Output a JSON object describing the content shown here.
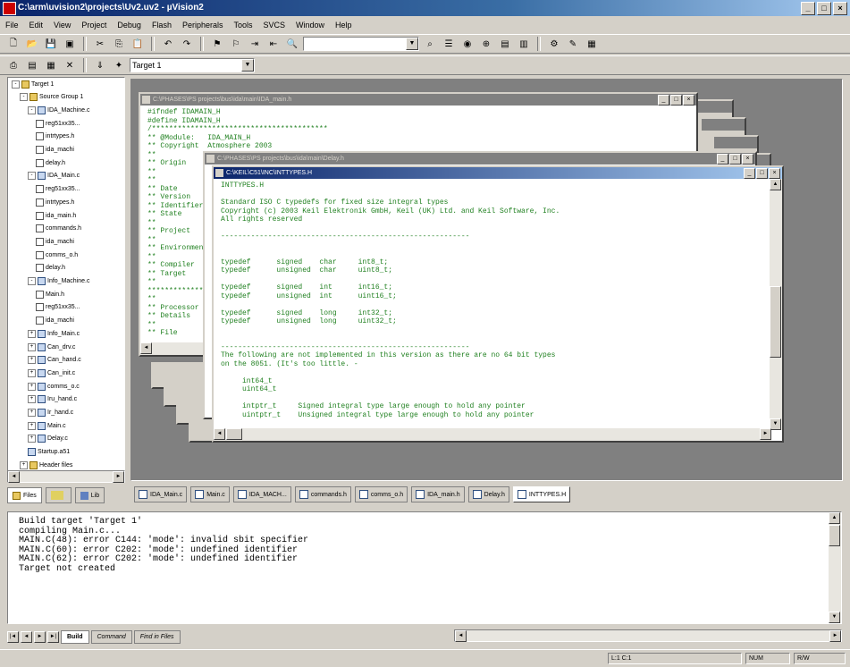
{
  "window": {
    "title": "C:\\arm\\uvision2\\projects\\Uv2.uv2 - µVision2"
  },
  "menu": [
    "File",
    "Edit",
    "View",
    "Project",
    "Debug",
    "Flash",
    "Peripherals",
    "Tools",
    "SVCS",
    "Window",
    "Help"
  ],
  "toolbar": {
    "target_select": "Target 1",
    "find_combo": ""
  },
  "tree": {
    "items": [
      {
        "label": "Target 1",
        "type": "folder",
        "level": 0,
        "expand": "-"
      },
      {
        "label": "Source Group 1",
        "type": "folder",
        "level": 1,
        "expand": "-"
      },
      {
        "label": "IDA_Machine.c",
        "type": "c",
        "level": 2,
        "expand": "-"
      },
      {
        "label": "reg51xx35...",
        "type": "file",
        "level": 3
      },
      {
        "label": "intrtypes.h",
        "type": "file",
        "level": 3
      },
      {
        "label": "ida_machi",
        "type": "file",
        "level": 3
      },
      {
        "label": "delay.h",
        "type": "file",
        "level": 3
      },
      {
        "label": "IDA_Main.c",
        "type": "c",
        "level": 2,
        "expand": "-"
      },
      {
        "label": "reg51xx35...",
        "type": "file",
        "level": 3
      },
      {
        "label": "intrtypes.h",
        "type": "file",
        "level": 3
      },
      {
        "label": "ida_main.h",
        "type": "file",
        "level": 3
      },
      {
        "label": "commands.h",
        "type": "file",
        "level": 3
      },
      {
        "label": "ida_machi",
        "type": "file",
        "level": 3
      },
      {
        "label": "comms_o.h",
        "type": "file",
        "level": 3
      },
      {
        "label": "delay.h",
        "type": "file",
        "level": 3
      },
      {
        "label": "Info_Machine.c",
        "type": "c",
        "level": 2,
        "expand": "-"
      },
      {
        "label": "Main.h",
        "type": "file",
        "level": 3
      },
      {
        "label": "reg51xx35...",
        "type": "file",
        "level": 3
      },
      {
        "label": "ida_machi",
        "type": "file",
        "level": 3
      },
      {
        "label": "Info_Main.c",
        "type": "c",
        "level": 2,
        "expand": "+"
      },
      {
        "label": "Can_drv.c",
        "type": "c",
        "level": 2,
        "expand": "+"
      },
      {
        "label": "Can_hand.c",
        "type": "c",
        "level": 2,
        "expand": "+"
      },
      {
        "label": "Can_init.c",
        "type": "c",
        "level": 2,
        "expand": "+"
      },
      {
        "label": "comms_o.c",
        "type": "c",
        "level": 2,
        "expand": "+"
      },
      {
        "label": "Iru_hand.c",
        "type": "c",
        "level": 2,
        "expand": "+"
      },
      {
        "label": "Ir_hand.c",
        "type": "c",
        "level": 2,
        "expand": "+"
      },
      {
        "label": "Main.c",
        "type": "c",
        "level": 2,
        "expand": "+"
      },
      {
        "label": "Delay.c",
        "type": "c",
        "level": 2,
        "expand": "+"
      },
      {
        "label": "Startup.a51",
        "type": "c",
        "level": 2
      },
      {
        "label": "Header files",
        "type": "folder",
        "level": 1,
        "expand": "+"
      }
    ]
  },
  "left_tabs": [
    "Files",
    "",
    "Lib"
  ],
  "docs": {
    "back": {
      "caption": "C:\\PHASES\\PS projects\\bus\\ida\\main\\IDA_main.h",
      "code": "#ifndef IDAMAIN_H\n#define IDAMAIN_H\n/*****************************************\n** @Module:   IDA_MAIN_H\n** Copyright  Atmosphere 2003\n**\n** Origin\n**\n**\n** Date\n** Version\n** Identifier\n** State\n**\n** Project\n**\n** Environment\n**\n** Compiler\n** Target\n**\n*****************************************\n**\n** Processor\n** Details\n**\n** File"
    },
    "mid": {
      "caption": "C:\\PHASES\\PS projects\\bus\\ida\\main\\Delay.h"
    },
    "front": {
      "caption": "C:\\KEIL\\C51\\INC\\INTTYPES.H",
      "code": "INTTYPES.H\n\nStandard ISO C typedefs for fixed size integral types\nCopyright (c) 2003 Keil Elektronik GmbH, Keil (UK) Ltd. and Keil Software, Inc.\nAll rights reserved\n\n----------------------------------------------------------\n\n\ntypedef      signed    char     int8_t;\ntypedef      unsigned  char     uint8_t;\n\ntypedef      signed    int      int16_t;\ntypedef      unsigned  int      uint16_t;\n\ntypedef      signed    long     int32_t;\ntypedef      unsigned  long     uint32_t;\n\n\n----------------------------------------------------------\nThe following are not implemented in this version as there are no 64 bit types\non the 8051. (It's too little. -\n\n     int64_t\n     uint64_t\n\n     intptr_t     Signed integral type large enough to hold any pointer\n     uintptr_t    Unsigned integral type large enough to hold any pointer"
    }
  },
  "doc_tabs": [
    "IDA_Main.c",
    "Main.c",
    "IDA_MACH...",
    "commands.h",
    "comms_o.h",
    "IDA_main.h",
    "Delay.h",
    "INTTYPES.H"
  ],
  "output": {
    "text": "Build target 'Target 1'\ncompiling Main.c...\nMAIN.C(48): error C144: 'mode': invalid sbit specifier\nMAIN.C(60): error C202: 'mode': undefined identifier\nMAIN.C(62): error C202: 'mode': undefined identifier\nTarget not created"
  },
  "output_tabs": [
    "Build",
    "Command",
    "Find in Files"
  ],
  "status": {
    "position": "L:1 C:1",
    "num": "NUM",
    "rw": "R/W"
  }
}
